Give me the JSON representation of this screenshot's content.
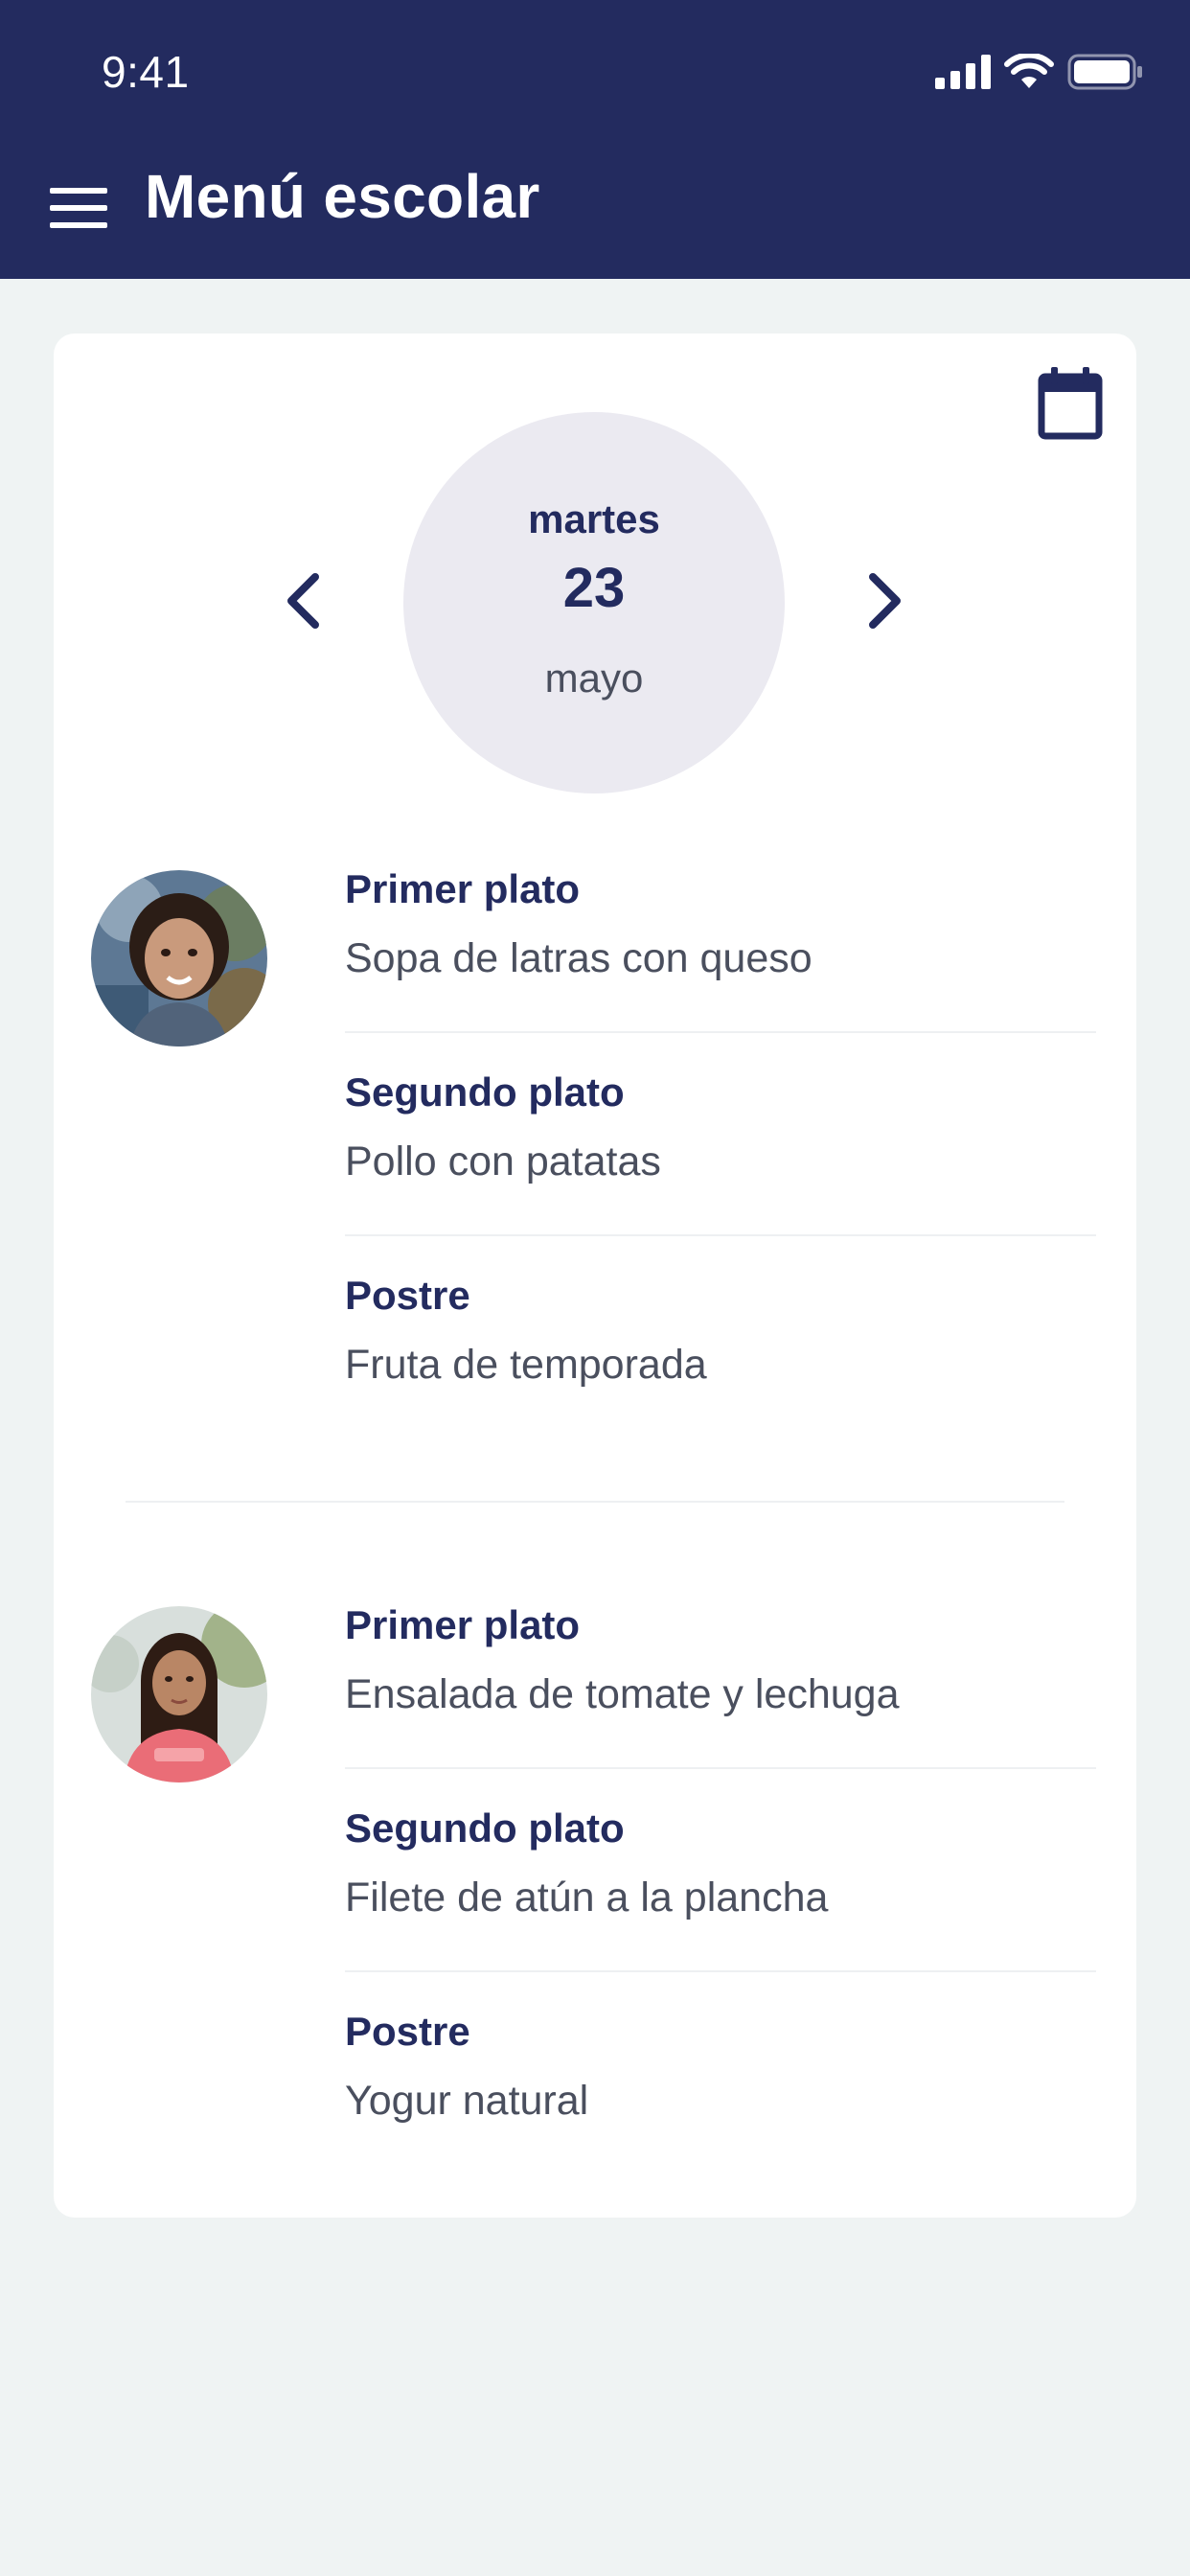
{
  "status_bar": {
    "time": "9:41"
  },
  "header": {
    "title": "Menú escolar",
    "menu_icon": "hamburger-menu-icon",
    "background": "#232b5f"
  },
  "date_selector": {
    "weekday": "martes",
    "day": "23",
    "month": "mayo",
    "prev_icon": "chevron-left-icon",
    "next_icon": "chevron-right-icon",
    "calendar_icon": "calendar-icon"
  },
  "menus": [
    {
      "avatar": "child-photo-boy",
      "courses": [
        {
          "label": "Primer plato",
          "dish": "Sopa de latras con queso"
        },
        {
          "label": "Segundo plato",
          "dish": "Pollo con patatas"
        },
        {
          "label": "Postre",
          "dish": "Fruta de temporada"
        }
      ]
    },
    {
      "avatar": "child-photo-girl",
      "courses": [
        {
          "label": "Primer plato",
          "dish": "Ensalada de tomate y lechuga"
        },
        {
          "label": "Segundo plato",
          "dish": "Filete de atún a la plancha"
        },
        {
          "label": "Postre",
          "dish": "Yogur natural"
        }
      ]
    }
  ],
  "colors": {
    "primary": "#232b5f",
    "text_secondary": "#4a4f5e",
    "page_background": "#eff3f3",
    "date_circle": "#ebeaf1"
  }
}
